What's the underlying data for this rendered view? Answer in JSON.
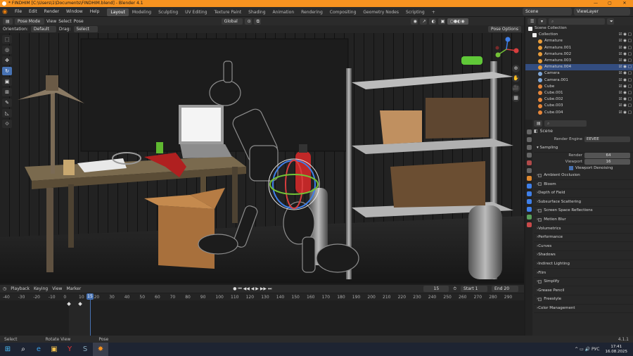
{
  "window": {
    "title": "* FINDHIM [C:\\Users\\1\\Documents\\FINDHIM.blend] - Blender 4.1",
    "min": "—",
    "max": "▢",
    "close": "✕"
  },
  "menu": [
    "File",
    "Edit",
    "Render",
    "Window",
    "Help"
  ],
  "workspaces": [
    "Layout",
    "Modeling",
    "Sculpting",
    "UV Editing",
    "Texture Paint",
    "Shading",
    "Animation",
    "Rendering",
    "Compositing",
    "Geometry Nodes",
    "Scripting"
  ],
  "workspace_add": "+",
  "scene_selector": "Scene",
  "view_layer": "ViewLayer",
  "viewport_header": {
    "mode": "Pose Mode",
    "menus": [
      "View",
      "Select",
      "Pose"
    ],
    "transform": "Global",
    "pose_options": "Pose Options"
  },
  "tool_header": {
    "orientation_label": "Orientation:",
    "orientation_value": "Default",
    "drag_label": "Drag:",
    "drag_value": "Select Box"
  },
  "tools": [
    {
      "name": "select-tool",
      "glyph": "⬚"
    },
    {
      "name": "cursor-tool",
      "glyph": "◎"
    },
    {
      "name": "move-tool",
      "glyph": "✥"
    },
    {
      "name": "rotate-tool",
      "glyph": "↻"
    },
    {
      "name": "scale-tool",
      "glyph": "▣"
    },
    {
      "name": "transform-tool",
      "glyph": "⊞"
    },
    {
      "name": "annotate-tool",
      "glyph": "✎"
    },
    {
      "name": "measure-tool",
      "glyph": "◺"
    },
    {
      "name": "pose-tool",
      "glyph": "⟐"
    }
  ],
  "active_tool": "rotate-tool",
  "nav_buttons": [
    "⊕",
    "✋",
    "🎥",
    "▦"
  ],
  "timeline": {
    "menus": [
      "Playback",
      "Keying",
      "View",
      "Marker"
    ],
    "current_frame": "15",
    "start_label": "Start",
    "start": "1",
    "end_label": "End",
    "end": "20",
    "ruler": [
      "-40",
      "-30",
      "-20",
      "-10",
      "0",
      "10",
      "20",
      "30",
      "40",
      "50",
      "60",
      "70",
      "80",
      "90",
      "100",
      "110",
      "120",
      "130",
      "140",
      "150",
      "160",
      "170",
      "180",
      "190",
      "200",
      "210",
      "220",
      "230",
      "240",
      "250",
      "260",
      "270",
      "280",
      "290"
    ],
    "playhead": "15"
  },
  "statusbar": {
    "select": "Select",
    "rotate": "Rotate View",
    "pose": "Pose",
    "version": "4.1.1"
  },
  "outliner": {
    "search_placeholder": "",
    "rows": [
      {
        "label": "Scene Collection",
        "type": "collection",
        "sel": false
      },
      {
        "label": "Collection",
        "type": "collection",
        "sel": false
      },
      {
        "label": "Armature",
        "type": "armature",
        "sel": false
      },
      {
        "label": "Armature.001",
        "type": "armature",
        "sel": false
      },
      {
        "label": "Armature.002",
        "type": "armature",
        "sel": false
      },
      {
        "label": "Armature.003",
        "type": "armature",
        "sel": false
      },
      {
        "label": "Armature.004",
        "type": "armature",
        "sel": true
      },
      {
        "label": "Camera",
        "type": "camera",
        "sel": false
      },
      {
        "label": "Camera.001",
        "type": "camera",
        "sel": false
      },
      {
        "label": "Cube",
        "type": "mesh",
        "sel": false
      },
      {
        "label": "Cube.001",
        "type": "mesh",
        "sel": false
      },
      {
        "label": "Cube.002",
        "type": "mesh",
        "sel": false
      },
      {
        "label": "Cube.003",
        "type": "mesh",
        "sel": false
      },
      {
        "label": "Cube.004",
        "type": "mesh",
        "sel": false
      }
    ]
  },
  "properties": {
    "context": "Scene",
    "render_engine_label": "Render Engine",
    "render_engine": "EEVEE",
    "sampling": "Sampling",
    "render_label": "Render",
    "render_samples": "64",
    "viewport_label": "Viewport",
    "viewport_samples": "16",
    "viewport_denoising": "Viewport Denoising",
    "sections": [
      {
        "label": "Ambient Occlusion",
        "cb": true
      },
      {
        "label": "Bloom",
        "cb": true
      },
      {
        "label": "Depth of Field",
        "cb": false
      },
      {
        "label": "Subsurface Scattering",
        "cb": false
      },
      {
        "label": "Screen Space Reflections",
        "cb": true
      },
      {
        "label": "Motion Blur",
        "cb": true
      },
      {
        "label": "Volumetrics",
        "cb": false
      },
      {
        "label": "Performance",
        "cb": false
      },
      {
        "label": "Curves",
        "cb": false
      },
      {
        "label": "Shadows",
        "cb": false
      },
      {
        "label": "Indirect Lighting",
        "cb": false
      },
      {
        "label": "Film",
        "cb": false
      },
      {
        "label": "Simplify",
        "cb": true
      },
      {
        "label": "Grease Pencil",
        "cb": false
      },
      {
        "label": "Freestyle",
        "cb": true
      },
      {
        "label": "Color Management",
        "cb": false
      }
    ]
  },
  "taskbar": {
    "apps": [
      "⊞",
      "⌕",
      "e",
      "▣",
      "Y",
      "S",
      "✸"
    ],
    "tray": "^  ▭  🔊  РУС",
    "time": "17:41",
    "date": "16.08.2025"
  },
  "colors": {
    "accent": "#4772b3",
    "title": "#f79320",
    "selected_row": "#334d80"
  }
}
